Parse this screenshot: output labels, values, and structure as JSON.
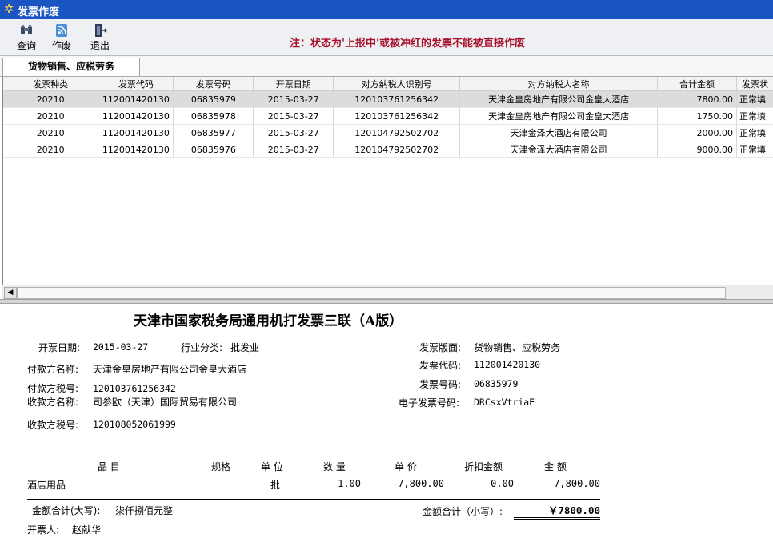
{
  "window": {
    "title": "发票作废"
  },
  "toolbar": {
    "query_label": "查询",
    "void_label": "作废",
    "exit_label": "退出",
    "notice": "注：状态为'上报中'或被冲红的发票不能被直接作废"
  },
  "tabs": [
    {
      "label": "货物销售、应税劳务"
    }
  ],
  "grid": {
    "columns": [
      "发票种类",
      "发票代码",
      "发票号码",
      "开票日期",
      "对方纳税人识别号",
      "对方纳税人名称",
      "合计金额",
      "发票状"
    ],
    "rows": [
      [
        "20210",
        "112001420130",
        "06835979",
        "2015-03-27",
        "120103761256342",
        "天津金皇房地产有限公司金皇大酒店",
        "7800.00",
        "正常填"
      ],
      [
        "20210",
        "112001420130",
        "06835978",
        "2015-03-27",
        "120103761256342",
        "天津金皇房地产有限公司金皇大酒店",
        "1750.00",
        "正常填"
      ],
      [
        "20210",
        "112001420130",
        "06835977",
        "2015-03-27",
        "120104792502702",
        "天津金泽大酒店有限公司",
        "2000.00",
        "正常填"
      ],
      [
        "20210",
        "112001420130",
        "06835976",
        "2015-03-27",
        "120104792502702",
        "天津金泽大酒店有限公司",
        "9000.00",
        "正常填"
      ]
    ],
    "selected_row": 0
  },
  "invoice": {
    "title": "天津市国家税务局通用机打发票三联（A版）",
    "issue_date_label": "开票日期:",
    "issue_date": "2015-03-27",
    "industry_label": "行业分类:",
    "industry": "批发业",
    "payer_name_label": "付款方名称:",
    "payer_name": "天津金皇房地产有限公司金皇大酒店",
    "payer_tax_label": "付款方税号:",
    "payer_tax": "120103761256342",
    "payee_name_label": "收款方名称:",
    "payee_name": "司参欧（天津）国际贸易有限公司",
    "payee_tax_label": "收款方税号:",
    "payee_tax": "120108052061999",
    "layout_label": "发票版面:",
    "layout": "货物销售、应税劳务",
    "code_label": "发票代码:",
    "code": "112001420130",
    "number_label": "发票号码:",
    "number": "06835979",
    "einvoice_label": "电子发票号码:",
    "einvoice": "DRCsxVtriaE",
    "items_header": {
      "name": "品 目",
      "spec": "规格",
      "unit": "单 位",
      "qty": "数 量",
      "price": "单 价",
      "discount": "折扣金额",
      "amount": "金 额"
    },
    "items": [
      {
        "name": "酒店用品",
        "spec": "",
        "unit": "批",
        "qty": "1.00",
        "price": "7,800.00",
        "discount": "0.00",
        "amount": "7,800.00"
      }
    ],
    "total_upper_label": "金额合计(大写):",
    "total_upper": "柒仟捌佰元整",
    "total_lower_label": "金额合计（小写）:",
    "total_lower": "￥7800.00",
    "drawer_label": "开票人:",
    "drawer": "赵献华"
  },
  "colors": {
    "titlebar": "#1b55c4",
    "notice": "#a8122b",
    "selected_row": "#dcdcdc"
  }
}
